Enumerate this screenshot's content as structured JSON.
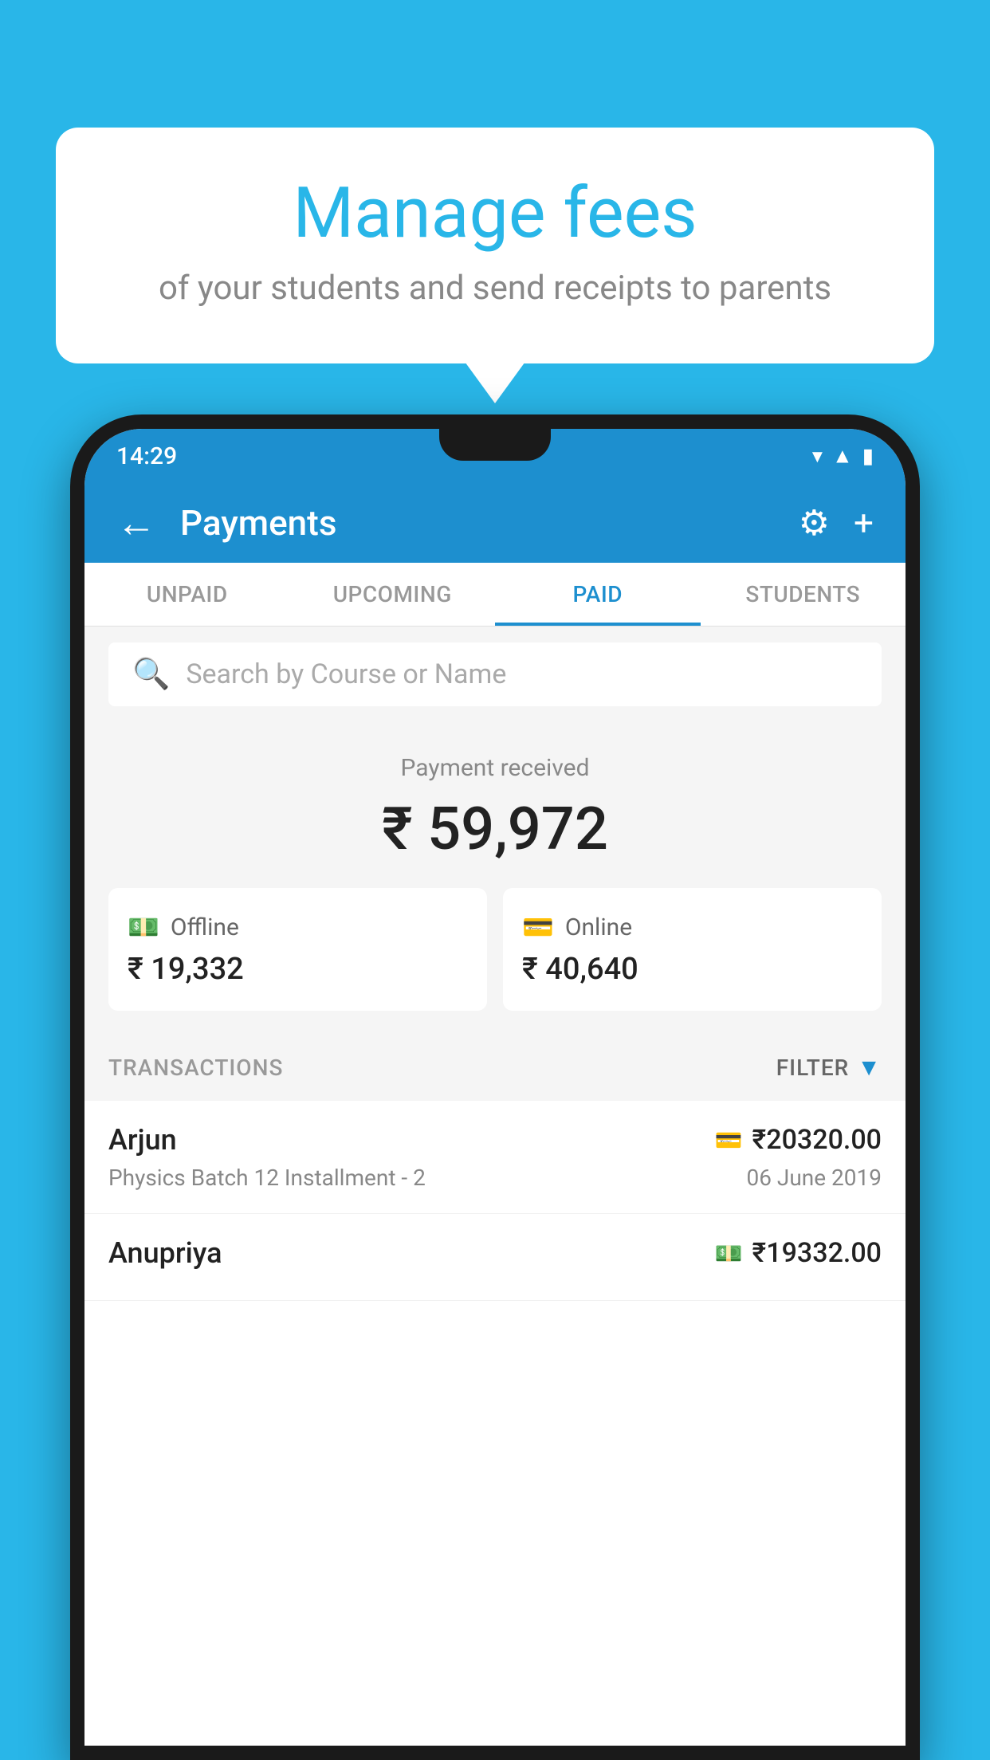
{
  "background": {
    "color": "#29b6e8"
  },
  "bubble": {
    "title": "Manage fees",
    "subtitle": "of your students and send receipts to parents"
  },
  "phone": {
    "statusBar": {
      "time": "14:29"
    },
    "appBar": {
      "title": "Payments",
      "backIcon": "←",
      "settingsIcon": "⚙",
      "addIcon": "+"
    },
    "tabs": [
      {
        "label": "UNPAID",
        "active": false
      },
      {
        "label": "UPCOMING",
        "active": false
      },
      {
        "label": "PAID",
        "active": true
      },
      {
        "label": "STUDENTS",
        "active": false
      }
    ],
    "search": {
      "placeholder": "Search by Course or Name"
    },
    "paymentSummary": {
      "label": "Payment received",
      "amount": "₹ 59,972",
      "offline": {
        "type": "Offline",
        "amount": "₹ 19,332"
      },
      "online": {
        "type": "Online",
        "amount": "₹ 40,640"
      }
    },
    "transactions": {
      "headerLabel": "TRANSACTIONS",
      "filterLabel": "FILTER",
      "items": [
        {
          "name": "Arjun",
          "description": "Physics Batch 12 Installment - 2",
          "amount": "₹20320.00",
          "date": "06 June 2019",
          "paymentType": "card"
        },
        {
          "name": "Anupriya",
          "description": "",
          "amount": "₹19332.00",
          "date": "",
          "paymentType": "cash"
        }
      ]
    }
  }
}
